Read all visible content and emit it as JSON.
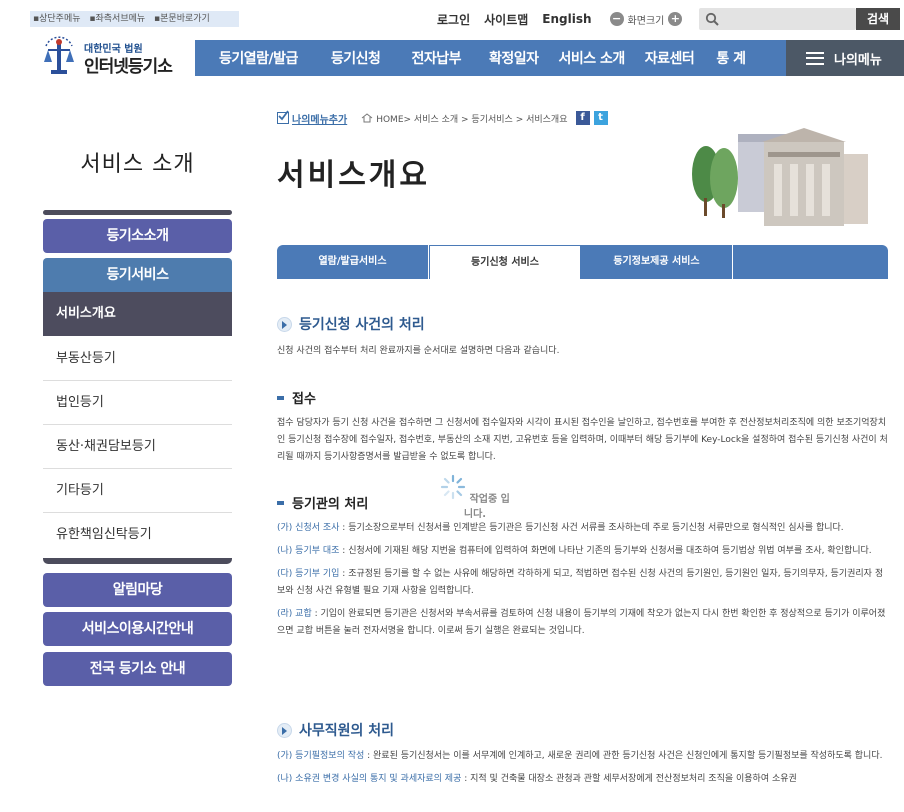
{
  "skip_links": [
    "▪상단주메뉴",
    "▪좌측서브메뉴",
    "▪본문바로가기"
  ],
  "top_links": {
    "login": "로그인",
    "sitemap": "사이트맵",
    "english": "English",
    "font_size_label": "화면크기",
    "font_minus": "−",
    "font_plus": "+"
  },
  "search": {
    "placeholder": "",
    "button": "검색"
  },
  "logo": {
    "subtitle": "대한민국 법원",
    "title": "인터넷등기소"
  },
  "gnb": [
    "등기열람/발급",
    "등기신청",
    "전자납부",
    "확정일자",
    "서비스 소개",
    "자료센터",
    "통 계"
  ],
  "my_menu": "나의메뉴",
  "lnb": {
    "title": "서비스 소개",
    "top_items": [
      "등기소소개",
      "등기서비스"
    ],
    "sub_items": [
      "서비스개요",
      "부동산등기",
      "법인등기",
      "동산·채권담보등기",
      "기타등기",
      "유한책임신탁등기"
    ],
    "bottom_items": [
      "알림마당",
      "서비스이용시간안내",
      "전국 등기소 안내"
    ]
  },
  "breadcrumb": {
    "add_menu": "나의메뉴추가",
    "path": "HOME> 서비스 소개 > 등기서비스 > 서비스개요",
    "facebook": "f",
    "twitter": "t"
  },
  "page_title": "서비스개요",
  "tabs": [
    "열람/발급서비스",
    "등기신청 서비스",
    "등기정보제공 서비스"
  ],
  "loading_text": "작업중 입니다.",
  "sections": {
    "s1_title": "등기신청 사건의 처리",
    "s1_intro": "신청 사건의 접수부터 처리 완료까지를 순서대로 설명하면 다음과 같습니다.",
    "s2_title": "접수",
    "s2_text": "접수 담당자가 등기 신청 사건을 접수하면 그 신청서에 접수일자와 시각이 표시된 접수인을 날인하고, 접수번호를 부여한 후 전산정보처리조직에 의한 보조기억장치인 등기신청 접수장에 접수일자, 접수번호, 부동산의 소재 지번, 고유번호 등을 입력하며, 이때부터 해당 등기부에 Key-Lock을 설정하여 접수된 등기신청 사건이 처리될 때까지 등기사항증명서를 발급받을 수 없도록 합니다.",
    "s3_title": "등기관의 처리",
    "s3_items": [
      {
        "label": "(가) 신청서 조사",
        "text": " : 등기소장으로부터 신청서를 인계받은 등기관은 등기신청 사건 서류를 조사하는데 주로 등기신청 서류만으로 형식적인 심사를 합니다."
      },
      {
        "label": "(나) 등기부 대조",
        "text": " : 신청서에 기재된 해당 지번을 컴퓨터에 입력하여 화면에 나타난 기존의 등기부와 신청서를 대조하여 등기법상 위법 여부를 조사, 확인합니다."
      },
      {
        "label": "(다) 등기부 기입",
        "text": " : 조규정된 등기를 할 수 없는 사유에 해당하면 각하하게 되고, 적법하면 접수된 신청 사건의 등기원인, 등기원인 일자, 등기의무자, 등기권리자 정보와 신청 사건 유형별 필요 기재 사항을 입력합니다."
      },
      {
        "label": "(라) 교합",
        "text": " : 기입이 완료되면 등기관은 신청서와 부속서류를 검토하여 신청 내용이 등기부의 기재에 착오가 없는지 다시 한번 확인한 후 정상적으로 등기가 이루어졌으면 교합 버튼을 눌러 전자서명을 합니다. 이로써 등기 실행은 완료되는 것입니다."
      }
    ],
    "s4_title": "사무직원의 처리",
    "s4_items": [
      {
        "label": "(가) 등기필정보의 작성",
        "text": " : 완료된 등기신청서는 이를 서무계에 인계하고, 새로운 권리에 관한 등기신청 사건은 신청인에게 통지할 등기필정보를 작성하도록 합니다."
      },
      {
        "label": "(나) 소유권 변경 사실의 통지 및 과세자료의 제공",
        "text": " : 지적 및 건축물 대장소 관청과 관할 세무서장에게 전산정보처리 조직을 이용하여 소유권"
      }
    ]
  },
  "colors": {
    "gnb": "#4b7ab7",
    "lnb_button": "#5a5fa8",
    "lnb_active": "#4d4c5e",
    "accent": "#3b6ea8"
  }
}
